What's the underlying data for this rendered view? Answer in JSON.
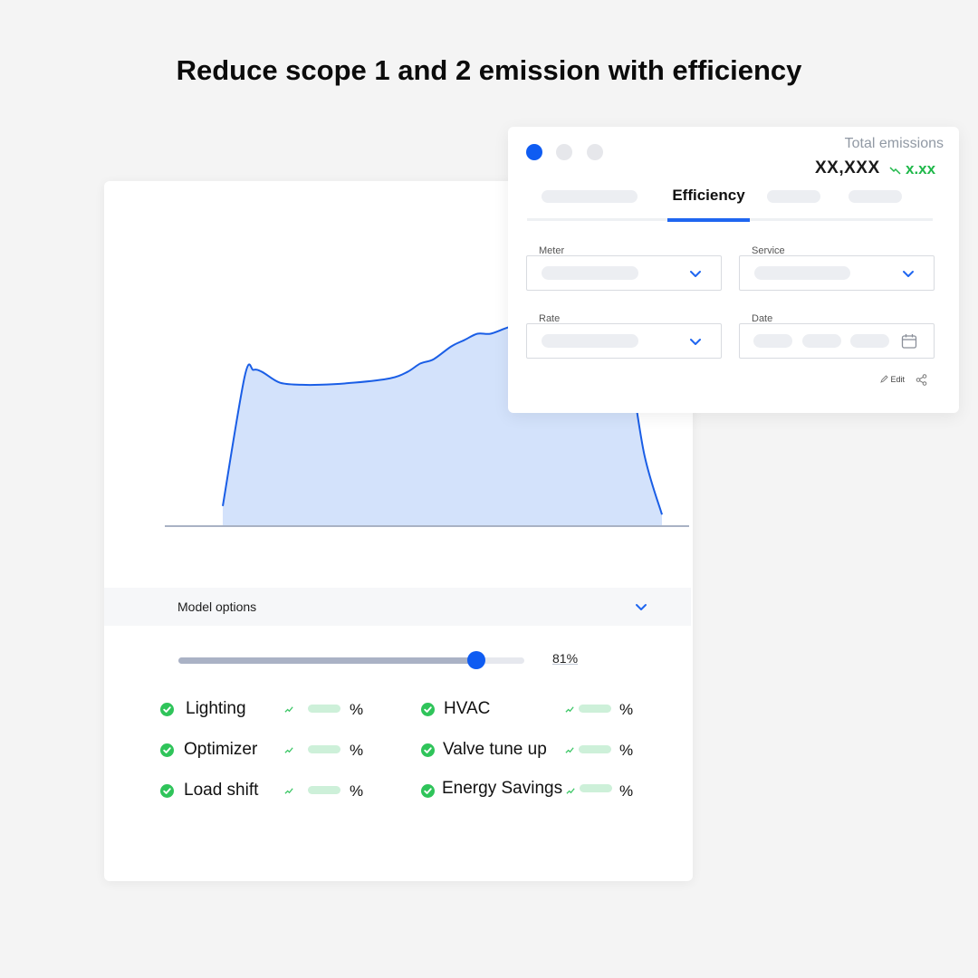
{
  "headline": "Reduce scope 1 and 2 emission with efficiency",
  "colors": {
    "accent": "#0f5cf2",
    "line": "#1a5ee6",
    "area_fill": "#d3e2fb",
    "success": "#2fc45a",
    "delta": "#1fb84a"
  },
  "main_card": {
    "model_options": {
      "label": "Model options",
      "icon": "chevron-down-icon"
    },
    "slider": {
      "value": 81,
      "value_label": "81%"
    },
    "options": [
      {
        "label": "Lighting",
        "pct": "%",
        "icon": "check-circle-icon"
      },
      {
        "label": "HVAC",
        "pct": "%",
        "icon": "check-circle-icon"
      },
      {
        "label": "Optimizer",
        "pct": "%",
        "icon": "check-circle-icon"
      },
      {
        "label": "Valve tune up",
        "pct": "%",
        "icon": "check-circle-icon"
      },
      {
        "label": "Load shift",
        "pct": "%",
        "icon": "check-circle-icon"
      },
      {
        "label": "Energy Savings",
        "pct": "%",
        "icon": "check-circle-icon"
      }
    ]
  },
  "chart_data": {
    "type": "area",
    "title": "",
    "xlabel": "",
    "ylabel": "",
    "grid": false,
    "legend": "none",
    "x": [
      0,
      0.05,
      0.07,
      0.09,
      0.13,
      0.18,
      0.22,
      0.3,
      0.38,
      0.42,
      0.45,
      0.48,
      0.52,
      0.55,
      0.58,
      0.61,
      0.65,
      0.7,
      0.75,
      0.78,
      0.83,
      0.88,
      0.92,
      0.96,
      1.0
    ],
    "y": [
      0.09,
      0.7,
      0.73,
      0.72,
      0.67,
      0.66,
      0.66,
      0.67,
      0.69,
      0.72,
      0.76,
      0.78,
      0.84,
      0.87,
      0.9,
      0.9,
      0.93,
      0.96,
      0.98,
      1.0,
      0.96,
      0.9,
      0.8,
      0.33,
      0.05
    ],
    "xlim": [
      0,
      1
    ],
    "ylim": [
      0,
      1
    ]
  },
  "float_card": {
    "window_dots": [
      "active",
      "inactive",
      "inactive"
    ],
    "total_label": "Total emissions",
    "total_value": "XX,XXX",
    "delta_icon": "trend-down-icon",
    "delta_value": "x.xx",
    "tabs": {
      "active": "Efficiency"
    },
    "fields": {
      "meter": {
        "label": "Meter",
        "icon": "chevron-down-icon"
      },
      "service": {
        "label": "Service",
        "icon": "chevron-down-icon"
      },
      "rate": {
        "label": "Rate",
        "icon": "chevron-down-icon"
      },
      "date": {
        "label": "Date",
        "icon": "calendar-icon"
      }
    },
    "edit_label": "Edit",
    "share_icon": "share-icon"
  }
}
